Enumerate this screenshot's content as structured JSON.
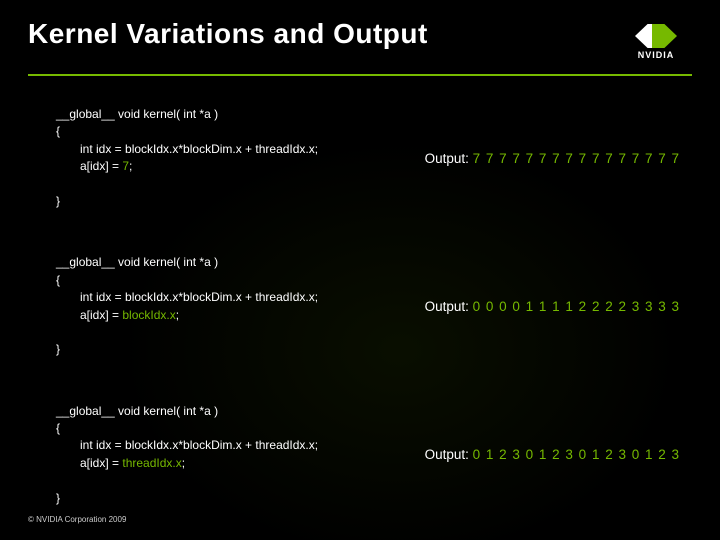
{
  "header": {
    "title": "Kernel Variations and Output",
    "logo_text": "NVIDIA"
  },
  "kernels": [
    {
      "sig": "__global__ void kernel( int *a )",
      "open": "{",
      "line_idx": "int idx = blockIdx.x*blockDim.x + threadIdx.x;",
      "line_assign_pre": "a[idx] = ",
      "line_assign_hl": "7",
      "line_assign_post": ";",
      "close": "}",
      "output_label": "Output:",
      "output_values": "7 7 7 7 7 7 7 7 7 7 7 7 7 7 7 7"
    },
    {
      "sig": "__global__ void kernel( int *a )",
      "open": "{",
      "line_idx": "int idx = blockIdx.x*blockDim.x + threadIdx.x;",
      "line_assign_pre": "a[idx] = ",
      "line_assign_hl": "blockIdx.x",
      "line_assign_post": ";",
      "close": "}",
      "output_label": "Output:",
      "output_values": "0 0 0 0 1 1 1 1 2 2 2 2 3 3 3 3"
    },
    {
      "sig": "__global__ void kernel( int *a )",
      "open": "{",
      "line_idx": "int idx = blockIdx.x*blockDim.x + threadIdx.x;",
      "line_assign_pre": "a[idx] = ",
      "line_assign_hl": "threadIdx.x",
      "line_assign_post": ";",
      "close": "}",
      "output_label": "Output:",
      "output_values": "0 1 2 3 0 1 2 3 0 1 2 3 0 1 2 3"
    }
  ],
  "footer": {
    "copyright": "© NVIDIA Corporation 2009"
  }
}
